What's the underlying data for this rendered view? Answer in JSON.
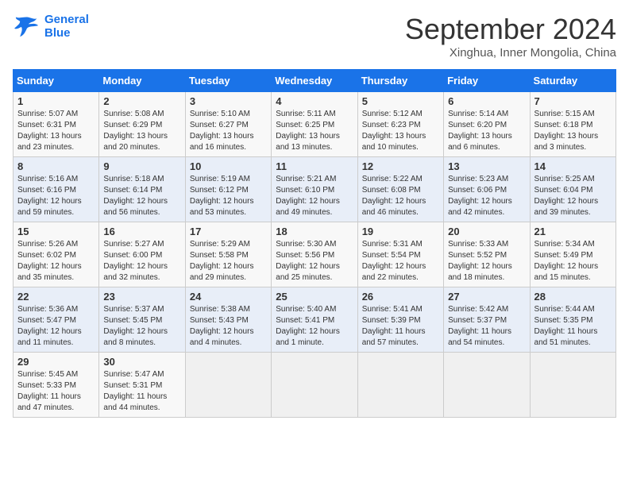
{
  "header": {
    "logo_line1": "General",
    "logo_line2": "Blue",
    "main_title": "September 2024",
    "subtitle": "Xinghua, Inner Mongolia, China"
  },
  "calendar": {
    "columns": [
      "Sunday",
      "Monday",
      "Tuesday",
      "Wednesday",
      "Thursday",
      "Friday",
      "Saturday"
    ],
    "rows": [
      [
        {
          "day": "1",
          "info": "Sunrise: 5:07 AM\nSunset: 6:31 PM\nDaylight: 13 hours\nand 23 minutes."
        },
        {
          "day": "2",
          "info": "Sunrise: 5:08 AM\nSunset: 6:29 PM\nDaylight: 13 hours\nand 20 minutes."
        },
        {
          "day": "3",
          "info": "Sunrise: 5:10 AM\nSunset: 6:27 PM\nDaylight: 13 hours\nand 16 minutes."
        },
        {
          "day": "4",
          "info": "Sunrise: 5:11 AM\nSunset: 6:25 PM\nDaylight: 13 hours\nand 13 minutes."
        },
        {
          "day": "5",
          "info": "Sunrise: 5:12 AM\nSunset: 6:23 PM\nDaylight: 13 hours\nand 10 minutes."
        },
        {
          "day": "6",
          "info": "Sunrise: 5:14 AM\nSunset: 6:20 PM\nDaylight: 13 hours\nand 6 minutes."
        },
        {
          "day": "7",
          "info": "Sunrise: 5:15 AM\nSunset: 6:18 PM\nDaylight: 13 hours\nand 3 minutes."
        }
      ],
      [
        {
          "day": "8",
          "info": "Sunrise: 5:16 AM\nSunset: 6:16 PM\nDaylight: 12 hours\nand 59 minutes."
        },
        {
          "day": "9",
          "info": "Sunrise: 5:18 AM\nSunset: 6:14 PM\nDaylight: 12 hours\nand 56 minutes."
        },
        {
          "day": "10",
          "info": "Sunrise: 5:19 AM\nSunset: 6:12 PM\nDaylight: 12 hours\nand 53 minutes."
        },
        {
          "day": "11",
          "info": "Sunrise: 5:21 AM\nSunset: 6:10 PM\nDaylight: 12 hours\nand 49 minutes."
        },
        {
          "day": "12",
          "info": "Sunrise: 5:22 AM\nSunset: 6:08 PM\nDaylight: 12 hours\nand 46 minutes."
        },
        {
          "day": "13",
          "info": "Sunrise: 5:23 AM\nSunset: 6:06 PM\nDaylight: 12 hours\nand 42 minutes."
        },
        {
          "day": "14",
          "info": "Sunrise: 5:25 AM\nSunset: 6:04 PM\nDaylight: 12 hours\nand 39 minutes."
        }
      ],
      [
        {
          "day": "15",
          "info": "Sunrise: 5:26 AM\nSunset: 6:02 PM\nDaylight: 12 hours\nand 35 minutes."
        },
        {
          "day": "16",
          "info": "Sunrise: 5:27 AM\nSunset: 6:00 PM\nDaylight: 12 hours\nand 32 minutes."
        },
        {
          "day": "17",
          "info": "Sunrise: 5:29 AM\nSunset: 5:58 PM\nDaylight: 12 hours\nand 29 minutes."
        },
        {
          "day": "18",
          "info": "Sunrise: 5:30 AM\nSunset: 5:56 PM\nDaylight: 12 hours\nand 25 minutes."
        },
        {
          "day": "19",
          "info": "Sunrise: 5:31 AM\nSunset: 5:54 PM\nDaylight: 12 hours\nand 22 minutes."
        },
        {
          "day": "20",
          "info": "Sunrise: 5:33 AM\nSunset: 5:52 PM\nDaylight: 12 hours\nand 18 minutes."
        },
        {
          "day": "21",
          "info": "Sunrise: 5:34 AM\nSunset: 5:49 PM\nDaylight: 12 hours\nand 15 minutes."
        }
      ],
      [
        {
          "day": "22",
          "info": "Sunrise: 5:36 AM\nSunset: 5:47 PM\nDaylight: 12 hours\nand 11 minutes."
        },
        {
          "day": "23",
          "info": "Sunrise: 5:37 AM\nSunset: 5:45 PM\nDaylight: 12 hours\nand 8 minutes."
        },
        {
          "day": "24",
          "info": "Sunrise: 5:38 AM\nSunset: 5:43 PM\nDaylight: 12 hours\nand 4 minutes."
        },
        {
          "day": "25",
          "info": "Sunrise: 5:40 AM\nSunset: 5:41 PM\nDaylight: 12 hours\nand 1 minute."
        },
        {
          "day": "26",
          "info": "Sunrise: 5:41 AM\nSunset: 5:39 PM\nDaylight: 11 hours\nand 57 minutes."
        },
        {
          "day": "27",
          "info": "Sunrise: 5:42 AM\nSunset: 5:37 PM\nDaylight: 11 hours\nand 54 minutes."
        },
        {
          "day": "28",
          "info": "Sunrise: 5:44 AM\nSunset: 5:35 PM\nDaylight: 11 hours\nand 51 minutes."
        }
      ],
      [
        {
          "day": "29",
          "info": "Sunrise: 5:45 AM\nSunset: 5:33 PM\nDaylight: 11 hours\nand 47 minutes."
        },
        {
          "day": "30",
          "info": "Sunrise: 5:47 AM\nSunset: 5:31 PM\nDaylight: 11 hours\nand 44 minutes."
        },
        {
          "day": "",
          "info": ""
        },
        {
          "day": "",
          "info": ""
        },
        {
          "day": "",
          "info": ""
        },
        {
          "day": "",
          "info": ""
        },
        {
          "day": "",
          "info": ""
        }
      ]
    ]
  }
}
